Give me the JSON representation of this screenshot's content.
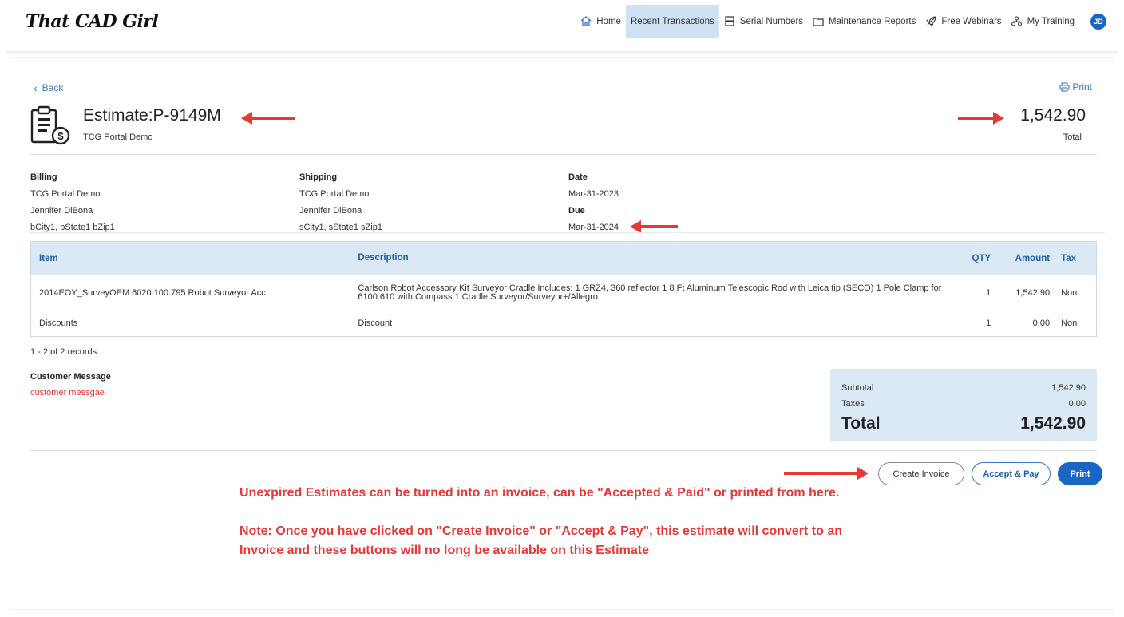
{
  "app": {
    "logo": "That CAD Girl"
  },
  "nav": {
    "items": [
      {
        "label": "Home",
        "icon": "home-icon"
      },
      {
        "label": "Recent Transactions",
        "icon": ""
      },
      {
        "label": "Serial Numbers",
        "icon": "server-icon"
      },
      {
        "label": "Maintenance Reports",
        "icon": "folder-icon"
      },
      {
        "label": "Free Webinars",
        "icon": "rocket-icon"
      },
      {
        "label": "My Training",
        "icon": "sitemap-icon"
      }
    ],
    "active": "Recent Transactions",
    "avatar": "JD"
  },
  "estimate": {
    "back_label": "Back",
    "print_label": "Print",
    "title": "Estimate:P-9149M",
    "customer": "TCG Portal Demo",
    "total": "1,542.90",
    "total_label": "Total"
  },
  "billing": {
    "heading": "Billing",
    "lines": [
      "TCG Portal Demo",
      "Jennifer DiBona",
      "bCity1, bState1 bZip1"
    ]
  },
  "shipping": {
    "heading": "Shipping",
    "lines": [
      "TCG Portal Demo",
      "Jennifer DiBona",
      "sCity1, sState1 sZip1"
    ]
  },
  "dates": {
    "date_heading": "Date",
    "date": "Mar-31-2023",
    "due_heading": "Due",
    "due": "Mar-31-2024"
  },
  "table": {
    "headers": {
      "item": "Item",
      "description": "Description",
      "qty": "QTY",
      "amount": "Amount",
      "tax": "Tax"
    },
    "rows": [
      {
        "item": "2014EOY_SurveyOEM:6020.100.795 Robot Surveyor Acc",
        "description": "Carlson Robot Accessory Kit Surveyor Cradle Includes: 1 GRZ4, 360 reflector 1 8 Ft Aluminum Telescopic Rod with Leica tip (SECO) 1 Pole Clamp for 6100.610 with Compass 1 Cradle Surveyor/Surveyor+/Allegro",
        "qty": "1",
        "amount": "1,542.90",
        "tax": "Non"
      },
      {
        "item": "Discounts",
        "description": "Discount",
        "qty": "1",
        "amount": "0.00",
        "tax": "Non"
      }
    ],
    "records": "1 - 2 of 2 records."
  },
  "customer_message": {
    "heading": "Customer Message",
    "text": "customer messgae"
  },
  "summary": {
    "subtotal_label": "Subtotal",
    "subtotal": "1,542.90",
    "taxes_label": "Taxes",
    "taxes": "0.00",
    "total_label": "Total",
    "total": "1,542.90"
  },
  "buttons": {
    "create_invoice": "Create Invoice",
    "accept_pay": "Accept & Pay",
    "print": "Print"
  },
  "annotation": {
    "line1": "Unexpired Estimates can be turned into an invoice, can be \"Accepted & Paid\" or printed from here.",
    "line2": "Note: Once you have clicked on \"Create Invoice\" or \"Accept & Pay\", this estimate will convert to an Invoice and these buttons will no long be available on this Estimate"
  },
  "colors": {
    "accent": "#1a66c5",
    "highlight": "#dbe9f5",
    "annotation": "#e53935"
  }
}
